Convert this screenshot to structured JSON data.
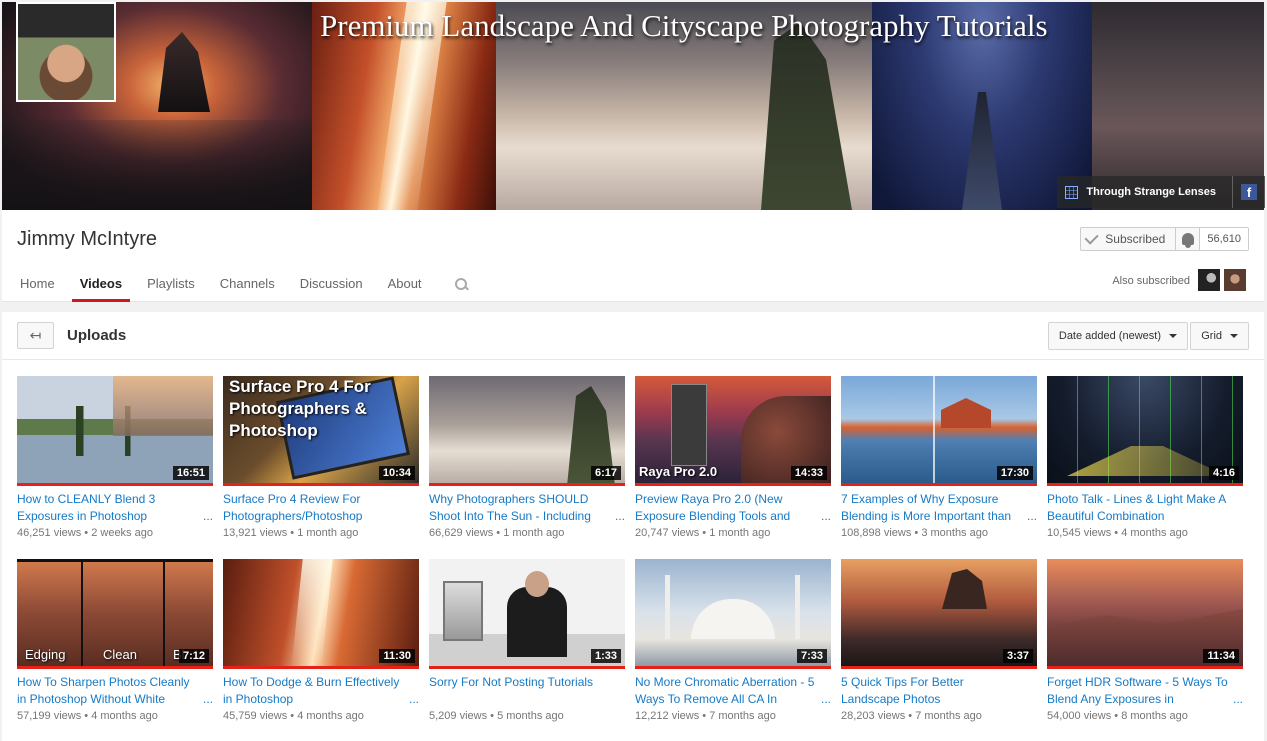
{
  "banner": {
    "title": "Premium Landscape And Cityscape Photography Tutorials",
    "link_label": "Through Strange Lenses",
    "facebook_glyph": "f"
  },
  "channel": {
    "name": "Jimmy McIntyre",
    "subscribed_label": "Subscribed",
    "subscriber_count": "56,610",
    "also_subscribed_label": "Also subscribed"
  },
  "tabs": [
    {
      "label": "Home"
    },
    {
      "label": "Videos"
    },
    {
      "label": "Playlists"
    },
    {
      "label": "Channels"
    },
    {
      "label": "Discussion"
    },
    {
      "label": "About"
    }
  ],
  "uploads": {
    "title": "Uploads",
    "back_glyph": "↤",
    "sort_label": "Date added (newest)",
    "view_label": "Grid"
  },
  "videos": [
    {
      "title": "How to CLEANLY Blend 3 Exposures in Photoshop",
      "duration": "16:51",
      "views": "46,251 views",
      "age": "2 weeks ago",
      "ellipsis": "..."
    },
    {
      "title": "Surface Pro 4 Review For Photographers/Photoshop",
      "duration": "10:34",
      "views": "13,921 views",
      "age": "1 month ago",
      "overlay": "Surface Pro 4 For Photographers & Photoshop"
    },
    {
      "title": "Why Photographers SHOULD Shoot Into The Sun - Including",
      "duration": "6:17",
      "views": "66,629 views",
      "age": "1 month ago",
      "ellipsis": "..."
    },
    {
      "title": "Preview Raya Pro 2.0 (New Exposure Blending Tools and",
      "duration": "14:33",
      "views": "20,747 views",
      "age": "1 month ago",
      "ellipsis": "...",
      "overlay": "Raya Pro 2.0"
    },
    {
      "title": "7 Examples of Why Exposure Blending is More Important than",
      "duration": "17:30",
      "views": "108,898 views",
      "age": "3 months ago",
      "ellipsis": "..."
    },
    {
      "title": "Photo Talk - Lines & Light Make A Beautiful Combination",
      "duration": "4:16",
      "views": "10,545 views",
      "age": "4 months ago"
    },
    {
      "title": "How To Sharpen Photos Cleanly in Photoshop Without White",
      "duration": "7:12",
      "views": "57,199 views",
      "age": "4 months ago",
      "ellipsis": "...",
      "overlay_left": "Edging",
      "overlay_mid": "Clean",
      "overlay_right": "Bl"
    },
    {
      "title": "How To Dodge & Burn Effectively in Photoshop",
      "duration": "11:30",
      "views": "45,759 views",
      "age": "4 months ago",
      "ellipsis": "..."
    },
    {
      "title": "Sorry For Not Posting Tutorials",
      "duration": "1:33",
      "views": "5,209 views",
      "age": "5 months ago"
    },
    {
      "title": "No More Chromatic Aberration - 5 Ways To Remove All CA In",
      "duration": "7:33",
      "views": "12,212 views",
      "age": "7 months ago",
      "ellipsis": "..."
    },
    {
      "title": "5 Quick Tips For Better Landscape Photos",
      "duration": "3:37",
      "views": "28,203 views",
      "age": "7 months ago"
    },
    {
      "title": "Forget HDR Software - 5 Ways To Blend Any Exposures in",
      "duration": "11:34",
      "views": "54,000 views",
      "age": "8 months ago",
      "ellipsis": "..."
    }
  ],
  "meta_separator": "•",
  "colors": {
    "accent_red": "#e62117",
    "link_blue": "#167ac6"
  }
}
